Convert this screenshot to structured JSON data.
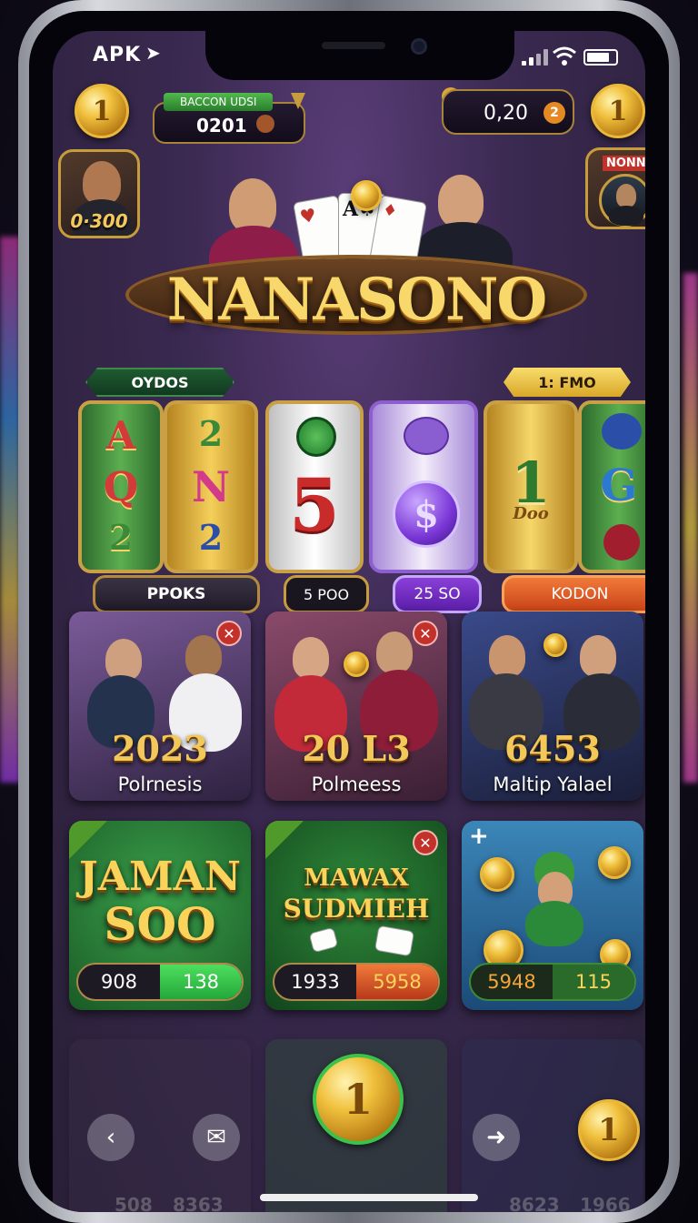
{
  "status_bar": {
    "carrier": "APK"
  },
  "header": {
    "left_coin": "1",
    "center_badge": "BACCON UDSI",
    "center_value": "0201",
    "right_value": "0,20",
    "right_badge": "2",
    "right_coin": "1"
  },
  "left_avatar": {
    "value": "0·300"
  },
  "right_avatar": {
    "badge": "NONN"
  },
  "game": {
    "logo": "NANASONO"
  },
  "slot": {
    "tag_left": "OYDOS",
    "tag_right": "1: FMO",
    "reel1_symbols": [
      "A",
      "Q",
      "2"
    ],
    "reel1b_symbols": [
      "2",
      "N",
      "2"
    ],
    "reel2_symbol": "5",
    "reel3_symbol": "$",
    "reel4_symbol": "1",
    "reel4_sub": "Doo",
    "reel5_symbol": "G",
    "buttons": [
      "PPOKS",
      "5 POO",
      "25 SO",
      "KODON"
    ]
  },
  "tiles_row1": [
    {
      "score": "2023",
      "name": "Polrnesis"
    },
    {
      "score": "20 L3",
      "name": "Polmeess"
    },
    {
      "score": "6453",
      "name": "Maltip Yalael"
    }
  ],
  "tiles_row2": [
    {
      "title_line1": "JAMAN",
      "title_line2": "SOO",
      "bar_left": "908",
      "bar_right": "138"
    },
    {
      "title_line1": "MAWAX",
      "title_line2": "SUDMIEH",
      "bar_left": "1933",
      "bar_right": "5958"
    },
    {
      "bar_left": "5948",
      "bar_right": "115"
    }
  ],
  "tiles_row3": {
    "center_coin": "1",
    "right_coin": "1",
    "numbers": [
      "508",
      "8363",
      "8623",
      "1966"
    ]
  },
  "colors": {
    "gold": "#f2c85a",
    "purple": "#3a2950",
    "green": "#2a8a3a",
    "red": "#c2312a"
  }
}
